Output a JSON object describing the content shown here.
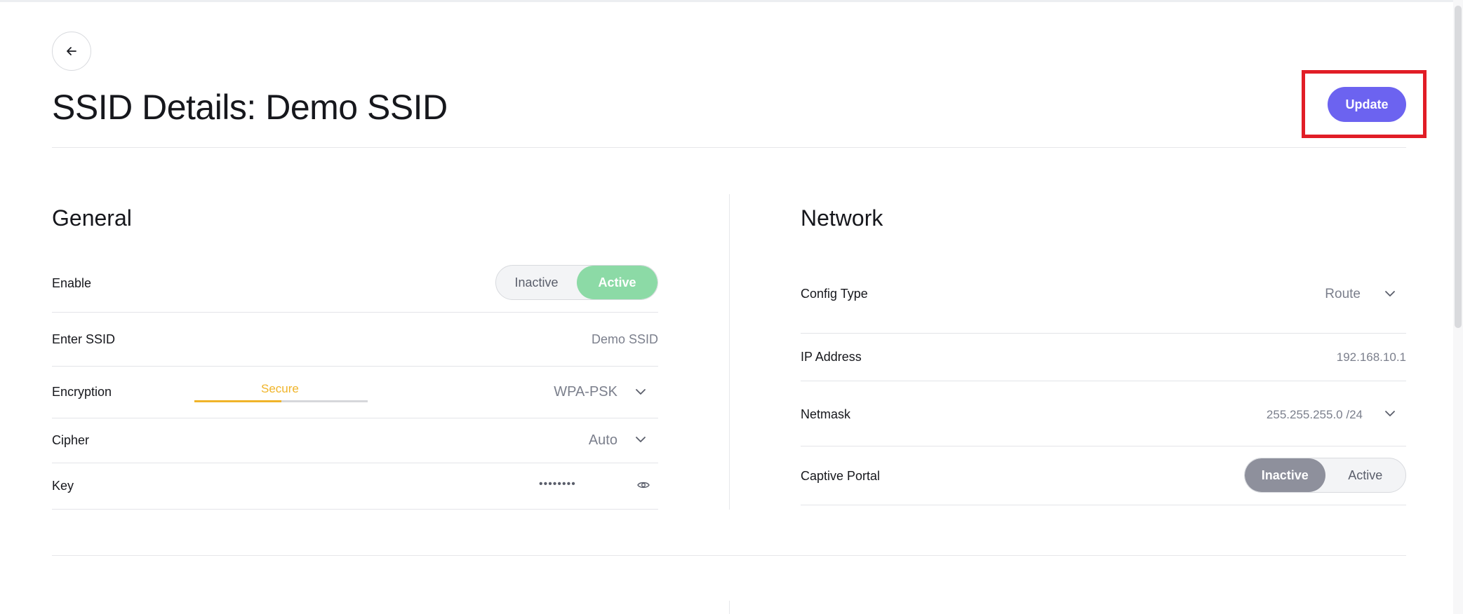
{
  "header": {
    "title": "SSID Details: Demo SSID",
    "update_label": "Update"
  },
  "general": {
    "title": "General",
    "enable": {
      "label": "Enable",
      "options": [
        "Inactive",
        "Active"
      ],
      "selected": "Active"
    },
    "ssid": {
      "label": "Enter SSID",
      "value": "Demo SSID"
    },
    "encryption": {
      "label": "Encryption",
      "strength": "Secure",
      "strength_level": 0.5,
      "value": "WPA-PSK"
    },
    "cipher": {
      "label": "Cipher",
      "value": "Auto"
    },
    "key": {
      "label": "Key",
      "value": "••••••••"
    }
  },
  "network": {
    "title": "Network",
    "config_type": {
      "label": "Config Type",
      "value": "Route"
    },
    "ip_address": {
      "label": "IP Address",
      "value": "192.168.10.1"
    },
    "netmask": {
      "label": "Netmask",
      "value": "255.255.255.0 /24"
    },
    "captive_portal": {
      "label": "Captive Portal",
      "options": [
        "Inactive",
        "Active"
      ],
      "selected": "Inactive"
    }
  },
  "icons": {
    "back": "arrow-left-icon",
    "dropdown": "chevron-down-icon",
    "show_key": "eye-icon"
  },
  "colors": {
    "accent": "#6c63f0",
    "active_green": "#8cdaa6",
    "inactive_gray": "#8e909c",
    "secure_amber": "#f0b429",
    "highlight_red": "#e11d26"
  }
}
